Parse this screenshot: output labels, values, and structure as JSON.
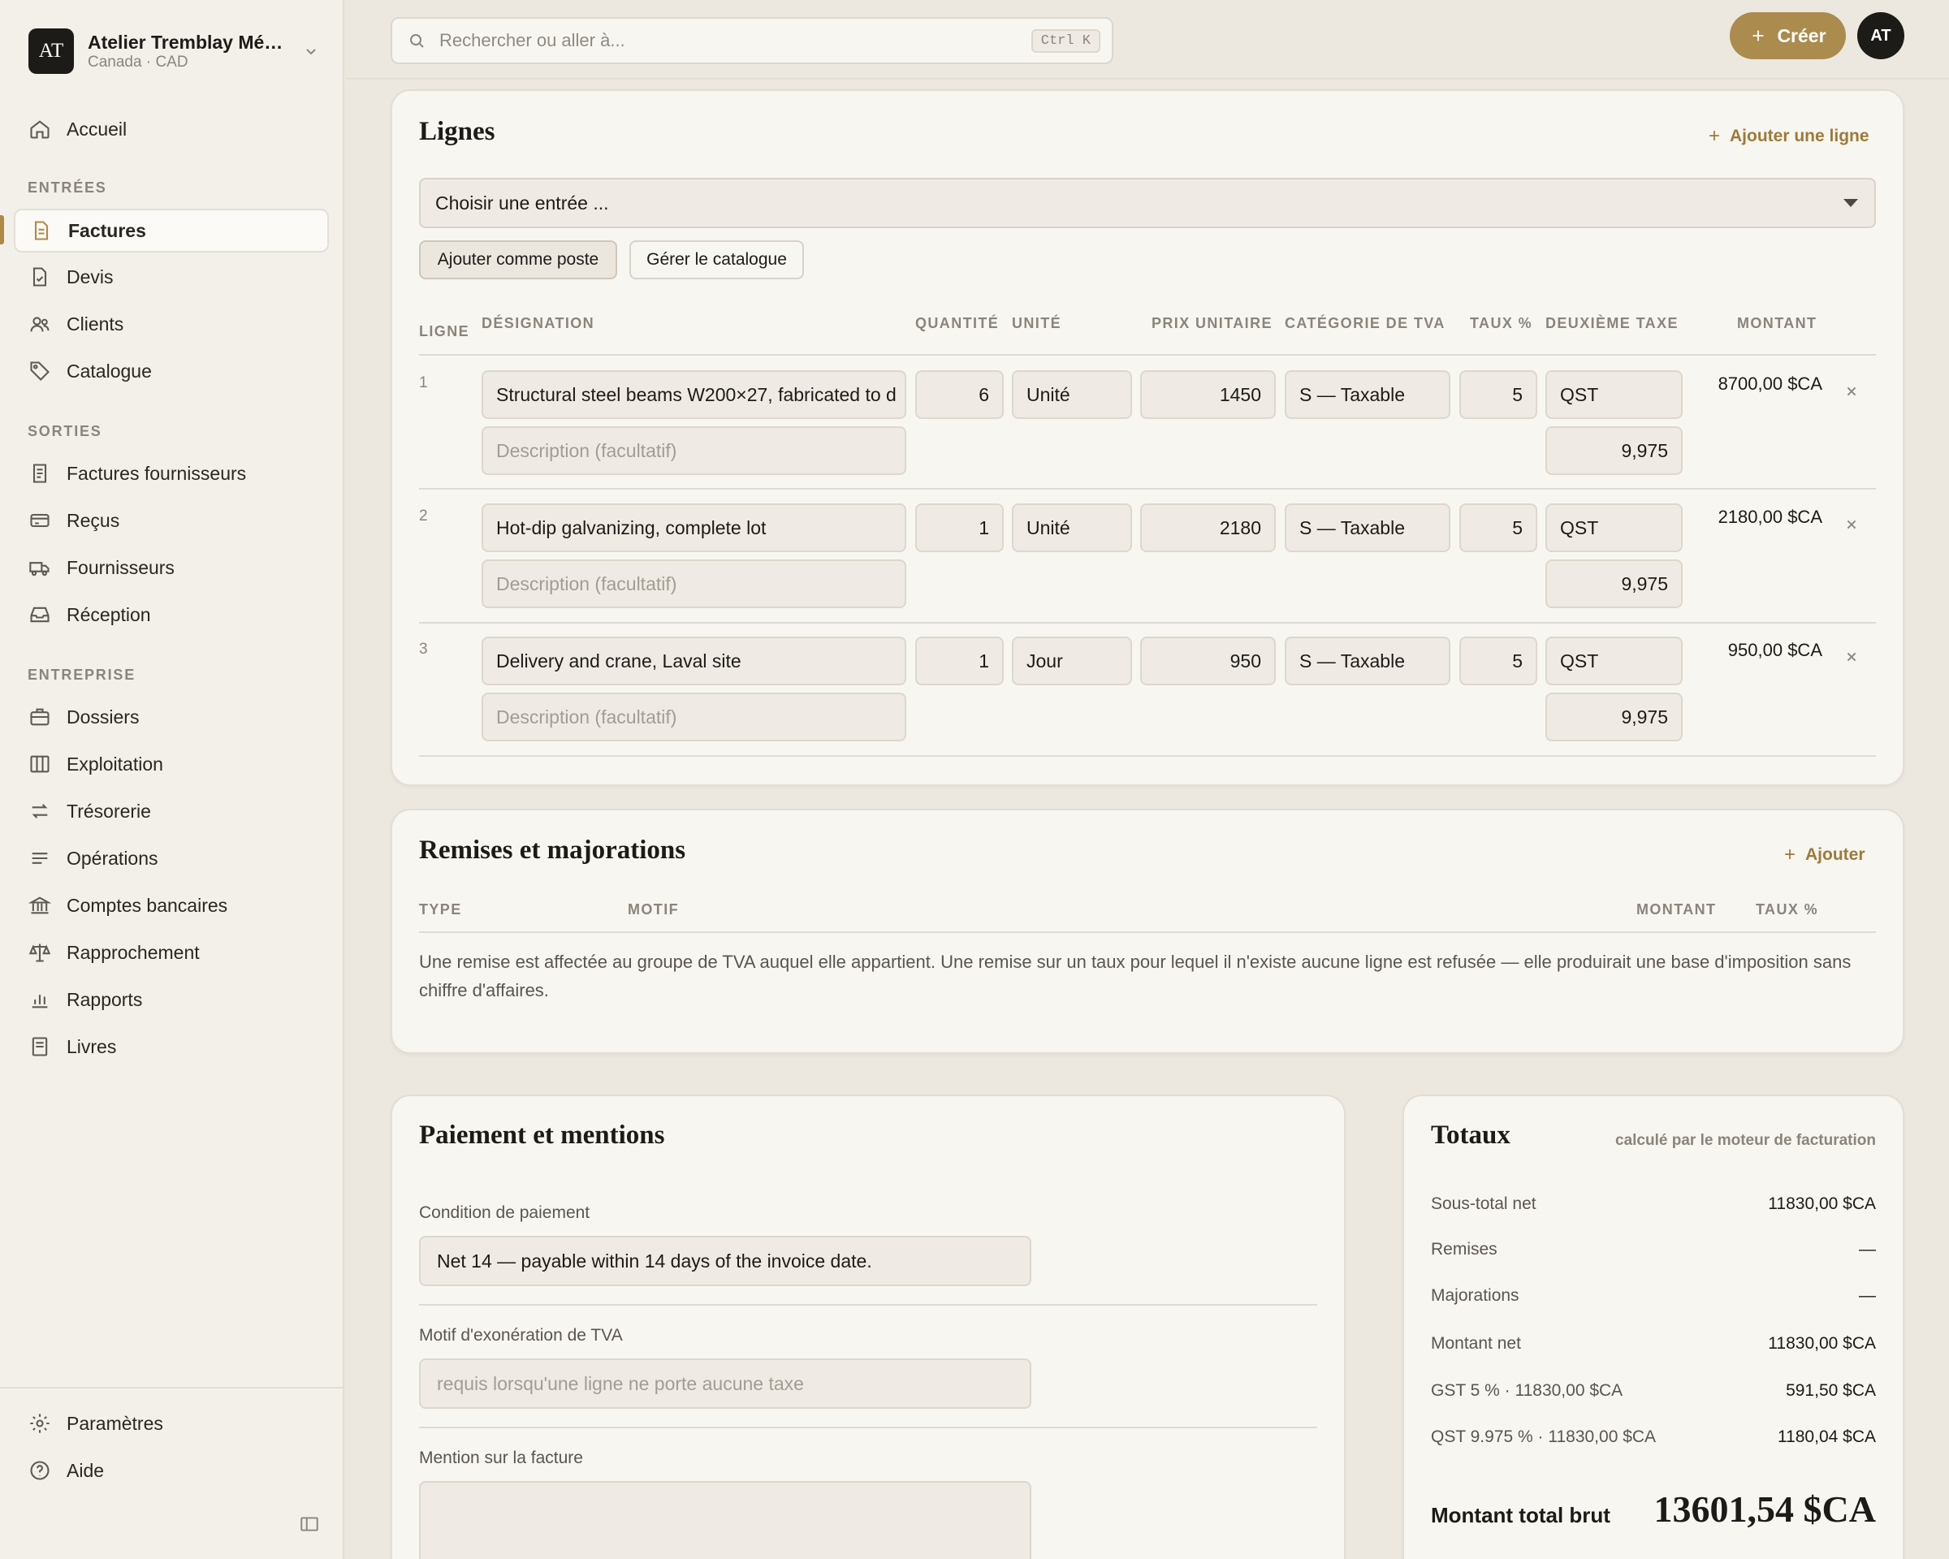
{
  "org": {
    "initials": "AT",
    "name": "Atelier Tremblay Mé…",
    "sub": "Canada · CAD"
  },
  "nav": {
    "home": "Accueil",
    "section_in": "ENTRÉES",
    "invoices": "Factures",
    "quotes": "Devis",
    "clients": "Clients",
    "catalog": "Catalogue",
    "section_out": "SORTIES",
    "supplier_invoices": "Factures fournisseurs",
    "receipts": "Reçus",
    "suppliers": "Fournisseurs",
    "reception": "Réception",
    "section_company": "ENTREPRISE",
    "files": "Dossiers",
    "operations_board": "Exploitation",
    "treasury": "Trésorerie",
    "operations": "Opérations",
    "bank_accounts": "Comptes bancaires",
    "reconciliation": "Rapprochement",
    "reports": "Rapports",
    "books": "Livres",
    "settings": "Paramètres",
    "help": "Aide"
  },
  "topbar": {
    "search_placeholder": "Rechercher ou aller à...",
    "shortcut": "Ctrl K",
    "create": "Créer",
    "avatar": "AT"
  },
  "lines": {
    "title": "Lignes",
    "add_line": "Ajouter une ligne",
    "select_placeholder": "Choisir une entrée ...",
    "add_as_item": "Ajouter comme poste",
    "manage_catalog": "Gérer le catalogue",
    "headers": {
      "line": "LIGNE",
      "designation": "DÉSIGNATION",
      "quantity": "QUANTITÉ",
      "unit": "UNITÉ",
      "unit_price": "PRIX UNITAIRE",
      "vat_category": "CATÉGORIE DE TVA",
      "rate": "TAUX %",
      "second_tax": "DEUXIÈME TAXE",
      "amount": "MONTANT"
    },
    "description_placeholder": "Description (facultatif)",
    "rows": [
      {
        "num": "1",
        "designation": "Structural steel beams W200×27, fabricated to d",
        "qty": "6",
        "unit": "Unité",
        "price": "1450",
        "category": "S — Taxable",
        "rate": "5",
        "tax2": "QST",
        "tax2_rate": "9,975",
        "amount": "8700,00 $CA"
      },
      {
        "num": "2",
        "designation": "Hot-dip galvanizing, complete lot",
        "qty": "1",
        "unit": "Unité",
        "price": "2180",
        "category": "S — Taxable",
        "rate": "5",
        "tax2": "QST",
        "tax2_rate": "9,975",
        "amount": "2180,00 $CA"
      },
      {
        "num": "3",
        "designation": "Delivery and crane, Laval site",
        "qty": "1",
        "unit": "Jour",
        "price": "950",
        "category": "S — Taxable",
        "rate": "5",
        "tax2": "QST",
        "tax2_rate": "9,975",
        "amount": "950,00 $CA"
      }
    ]
  },
  "discounts": {
    "title": "Remises et majorations",
    "add": "Ajouter",
    "headers": {
      "type": "TYPE",
      "reason": "MOTIF",
      "amount": "MONTANT",
      "rate": "TAUX %"
    },
    "note": "Une remise est affectée au groupe de TVA auquel elle appartient. Une remise sur un taux pour lequel il n'existe aucune ligne est refusée — elle produirait une base d'imposition sans chiffre d'affaires."
  },
  "payment": {
    "title": "Paiement et mentions",
    "condition_label": "Condition de paiement",
    "condition_value": "Net 14 — payable within 14 days of the invoice date.",
    "exemption_label": "Motif d'exonération de TVA",
    "exemption_placeholder": "requis lorsqu'une ligne ne porte aucune taxe",
    "mention_label": "Mention sur la facture"
  },
  "totals": {
    "title": "Totaux",
    "subtitle": "calculé par le moteur de facturation",
    "rows": [
      {
        "label": "Sous-total net",
        "value": "11830,00 $CA"
      },
      {
        "label": "Remises",
        "value": "—"
      },
      {
        "label": "Majorations",
        "value": "—"
      },
      {
        "label": "Montant net",
        "value": "11830,00 $CA"
      },
      {
        "label": "GST 5 % · 11830,00 $CA",
        "value": "591,50 $CA"
      },
      {
        "label": "QST 9.975 % · 11830,00 $CA",
        "value": "1180,04 $CA"
      }
    ],
    "grand_label": "Montant total brut",
    "grand_value": "13601,54 $CA"
  },
  "colors": {
    "accent": "#ab8c4e",
    "background": "#ece8e0",
    "card": "#f8f6f1",
    "dark": "#1d1b17"
  }
}
